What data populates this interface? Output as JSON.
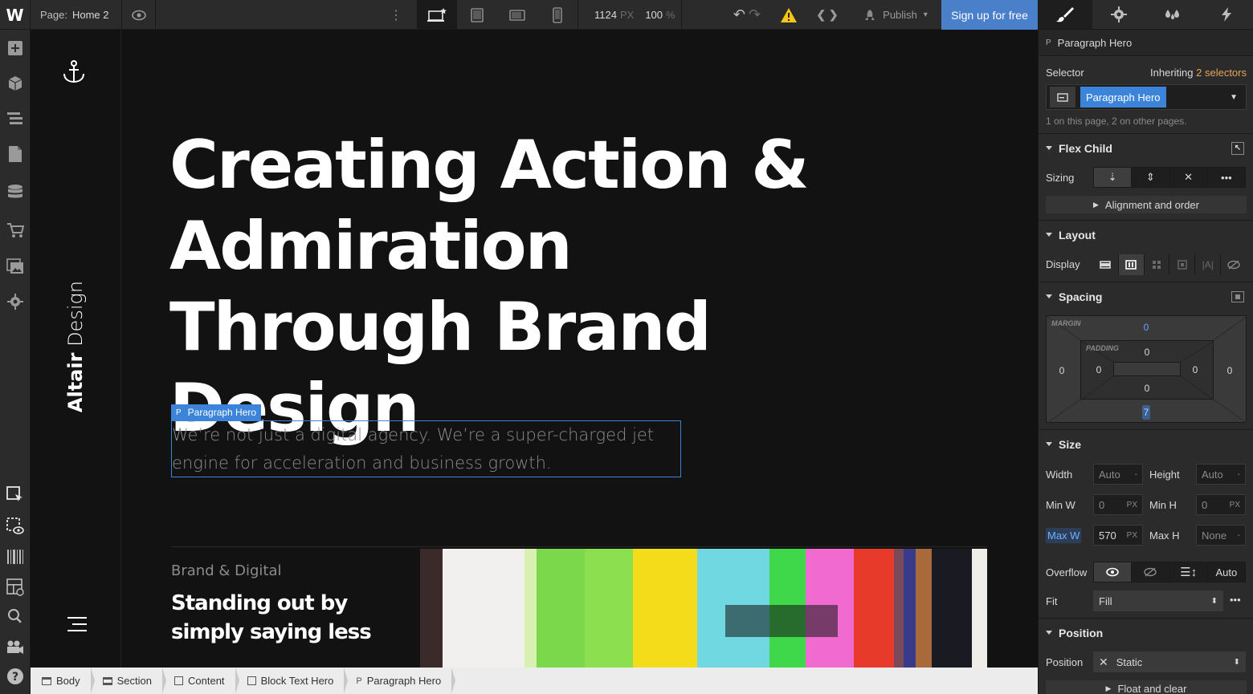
{
  "topbar": {
    "page_prefix": "Page:",
    "page_name": "Home 2",
    "width_value": "1124",
    "width_unit": "PX",
    "zoom_value": "100",
    "zoom_unit": "%",
    "publish_label": "Publish",
    "signup_label": "Sign up for free"
  },
  "canvas": {
    "brand_bold": "Altair",
    "brand_light": "Design",
    "hero_title": "Creating Action & Admiration Through Brand Design",
    "selection_tag": "Paragraph Hero",
    "hero_paragraph": "We’re not just a digital agency. We’re a super-charged jet engine for acceleration and business growth.",
    "category": "Brand & Digital",
    "subheading": "Standing out by simply saying less"
  },
  "breadcrumb": [
    {
      "label": "Body"
    },
    {
      "label": "Section"
    },
    {
      "label": "Content"
    },
    {
      "label": "Block Text Hero"
    },
    {
      "label": "Paragraph Hero"
    }
  ],
  "panel": {
    "element_name": "Paragraph Hero",
    "selector_label": "Selector",
    "inheriting_label": "Inheriting",
    "inheriting_link": "2 selectors",
    "selector_chip": "Paragraph Hero",
    "selector_note": "1 on this page, 2 on other pages.",
    "flex_child_title": "Flex Child",
    "sizing_label": "Sizing",
    "alignment_label": "Alignment and order",
    "layout_title": "Layout",
    "display_label": "Display",
    "spacing_title": "Spacing",
    "margin_label": "MARGIN",
    "padding_label": "PADDING",
    "margin_top": "0",
    "margin_right": "0",
    "margin_bottom": "7",
    "margin_left": "0",
    "padding_top": "0",
    "padding_right": "0",
    "padding_bottom": "0",
    "padding_left": "0",
    "size_title": "Size",
    "width_label": "Width",
    "width_value": "Auto",
    "height_label": "Height",
    "height_value": "Auto",
    "minw_label": "Min W",
    "minw_value": "0",
    "minh_label": "Min H",
    "minh_value": "0",
    "maxw_label": "Max W",
    "maxw_value": "570",
    "maxh_label": "Max H",
    "maxh_value": "None",
    "px_unit": "PX",
    "dash": "-",
    "overflow_label": "Overflow",
    "overflow_auto": "Auto",
    "fit_label": "Fit",
    "fit_value": "Fill",
    "position_title": "Position",
    "position_label": "Position",
    "position_value": "Static",
    "float_label": "Float and clear"
  },
  "colors": {
    "accent_blue": "#4a7fc9",
    "selection_blue": "#3b84d9",
    "warning_yellow": "#f5c518",
    "link_orange": "#e8a55a"
  }
}
